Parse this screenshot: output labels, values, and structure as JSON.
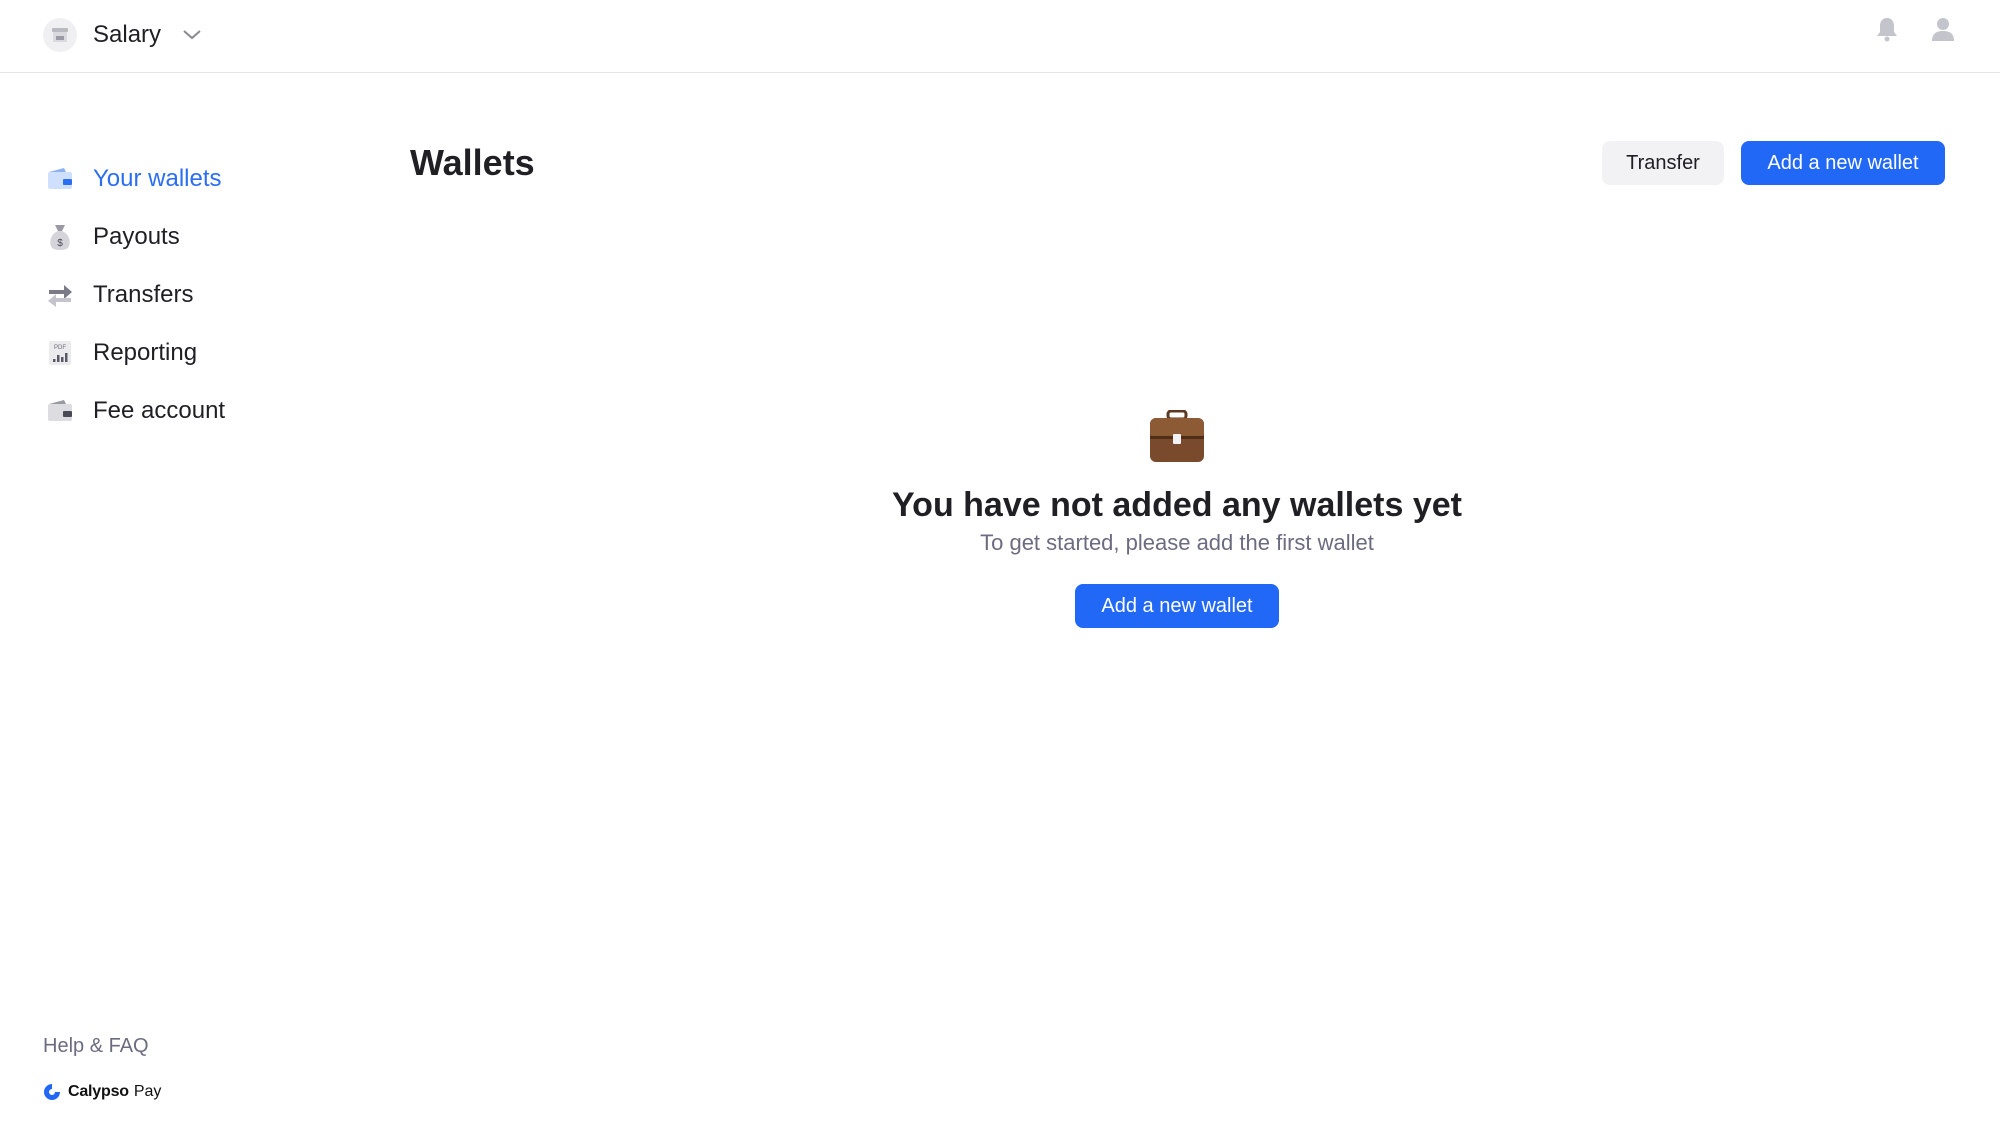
{
  "org": {
    "name": "Salary"
  },
  "sidebar": {
    "items": [
      {
        "label": "Your wallets",
        "icon": "wallet-icon",
        "active": true
      },
      {
        "label": "Payouts",
        "icon": "money-bag-icon",
        "active": false
      },
      {
        "label": "Transfers",
        "icon": "transfer-arrows-icon",
        "active": false
      },
      {
        "label": "Reporting",
        "icon": "pdf-report-icon",
        "active": false
      },
      {
        "label": "Fee account",
        "icon": "wallet-gray-icon",
        "active": false
      }
    ],
    "help_label": "Help & FAQ"
  },
  "brand": {
    "name": "Calypso",
    "suffix": "Pay",
    "color": "#2068f5"
  },
  "main": {
    "title": "Wallets",
    "transfer_label": "Transfer",
    "add_wallet_label": "Add a new wallet",
    "empty_state": {
      "icon": "briefcase-icon",
      "title": "You have not added any wallets yet",
      "subtitle": "To get started, please add the first wallet",
      "button_label": "Add a new wallet"
    }
  },
  "colors": {
    "accent": "#2068f5",
    "active_nav": "#2b6ef2",
    "muted_text": "#6c6c80"
  }
}
